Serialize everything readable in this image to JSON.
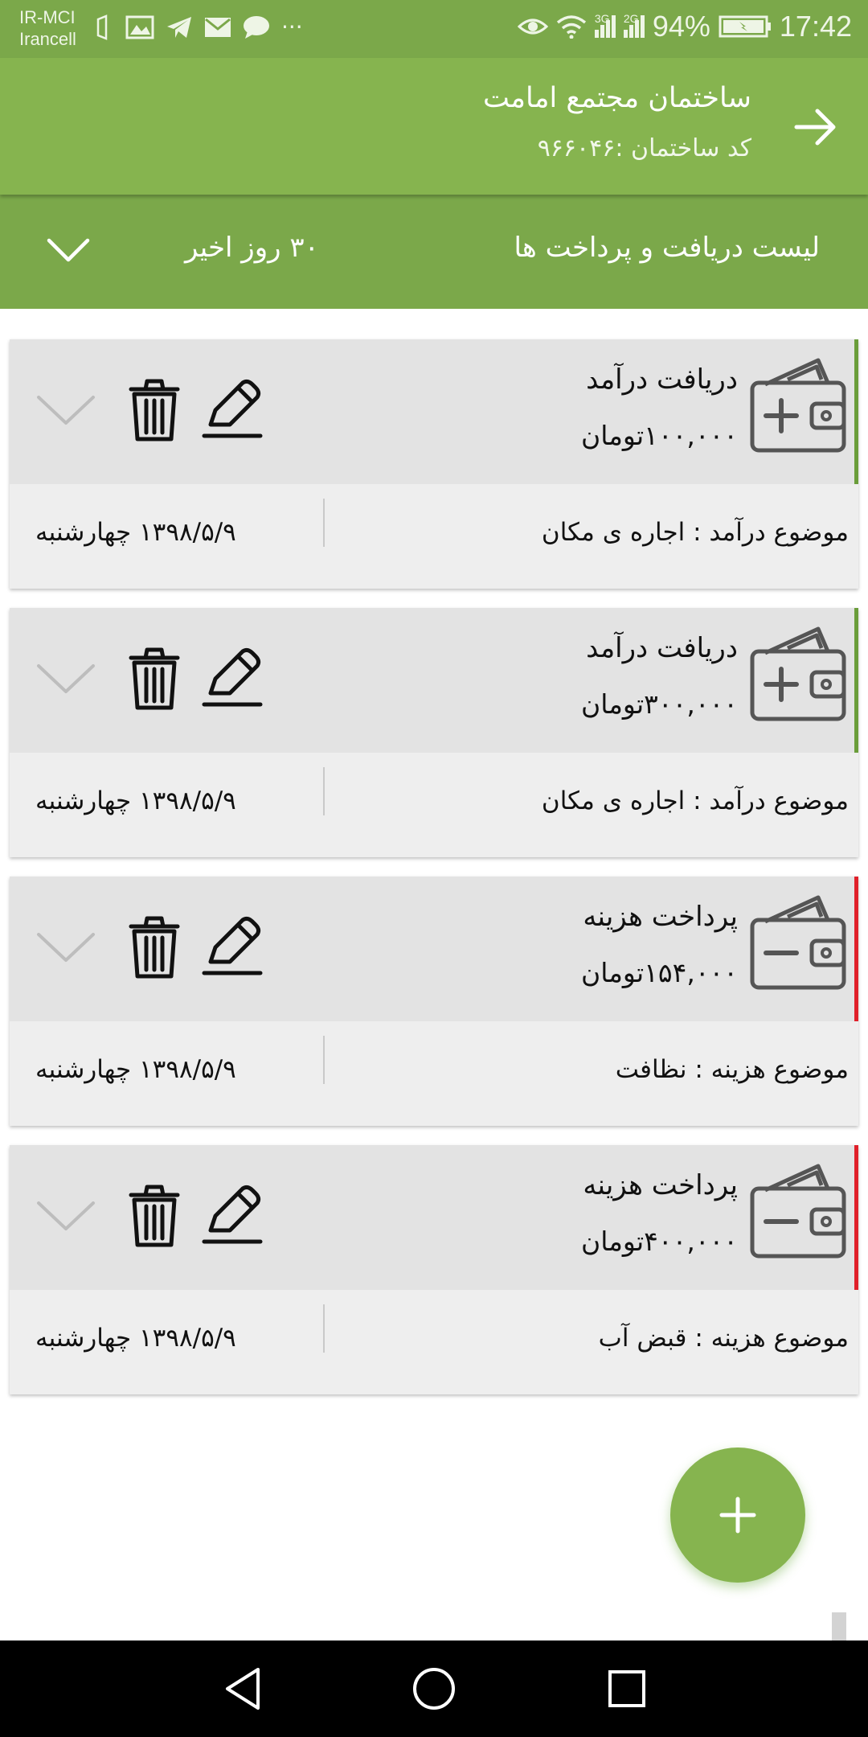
{
  "status_bar": {
    "carrier_line1": "IR-MCI",
    "carrier_line2": "Irancell",
    "network_1": "3G",
    "network_2": "2G",
    "battery": "94%",
    "time": "17:42"
  },
  "app_bar": {
    "title": "ساختمان مجتمع امامت",
    "subtitle": "کد ساختمان :۹۶۶۰۴۶"
  },
  "filter": {
    "title": "لیست دریافت و پرداخت ها",
    "range": "۳۰ روز اخیر"
  },
  "colors": {
    "primary": "#86b44f",
    "primary_dark": "#7ba84a",
    "income_accent": "#6a9d3a",
    "expense_accent": "#e0202a"
  },
  "transactions": [
    {
      "kind": "income",
      "type": "دریافت درآمد",
      "amount": "۱۰۰,۰۰۰تومان",
      "subject": "موضوع درآمد : اجاره ی مکان",
      "date": "۱۳۹۸/۵/۹ چهارشنبه",
      "icon": "wallet-plus-icon"
    },
    {
      "kind": "income",
      "type": "دریافت درآمد",
      "amount": "۳۰۰,۰۰۰تومان",
      "subject": "موضوع درآمد : اجاره ی مکان",
      "date": "۱۳۹۸/۵/۹ چهارشنبه",
      "icon": "wallet-plus-icon"
    },
    {
      "kind": "expense",
      "type": "پرداخت هزینه",
      "amount": "۱۵۴,۰۰۰تومان",
      "subject": "موضوع هزینه : نظافت",
      "date": "۱۳۹۸/۵/۹ چهارشنبه",
      "icon": "wallet-minus-icon"
    },
    {
      "kind": "expense",
      "type": "پرداخت هزینه",
      "amount": "۴۰۰,۰۰۰تومان",
      "subject": "موضوع هزینه : قبض آب",
      "date": "۱۳۹۸/۵/۹ چهارشنبه",
      "icon": "wallet-minus-icon"
    }
  ]
}
